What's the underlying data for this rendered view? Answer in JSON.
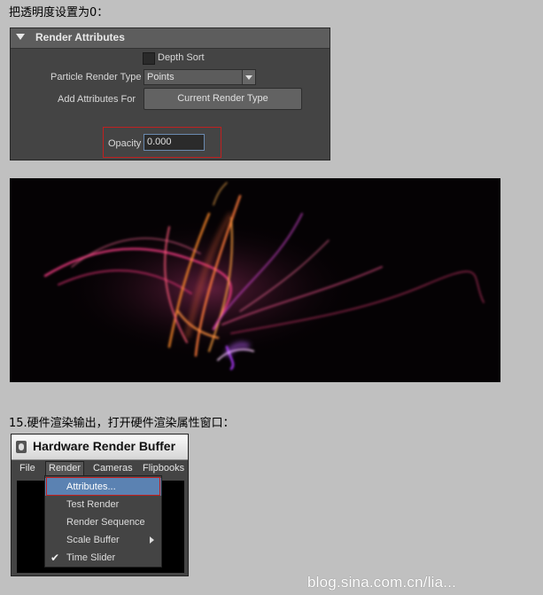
{
  "captions": {
    "step_opacity": "把透明度设置为0：",
    "step_15": "15.硬件渲染输出，打开硬件渲染属性窗口："
  },
  "attribute_panel": {
    "header": "Render Attributes",
    "depth_sort_label": "Depth Sort",
    "depth_sort_checked": false,
    "particle_render_type_label": "Particle Render Type",
    "particle_render_type_value": "Points",
    "add_attributes_for_label": "Add Attributes For",
    "current_render_type_button": "Current Render Type",
    "opacity_label": "Opacity",
    "opacity_value": "0.000",
    "highlight_color": "#c02020"
  },
  "render_preview": {
    "background": "#050204",
    "colors": [
      "#ff8a2a",
      "#ff3f8a",
      "#b03cff",
      "#ffd0ff"
    ]
  },
  "hardware_render_buffer": {
    "title": "Hardware Render Buffer",
    "menubar": [
      "File",
      "Render",
      "Cameras",
      "Flipbooks"
    ],
    "render_menu": {
      "items": [
        "Attributes...",
        "Test Render",
        "Render Sequence",
        "Scale Buffer",
        "Time Slider"
      ],
      "highlighted": "Attributes...",
      "time_slider_checked": true,
      "highlight_color": "#5b82b2"
    }
  },
  "watermark": {
    "text": "blog.sina.com.cn/lia..."
  }
}
